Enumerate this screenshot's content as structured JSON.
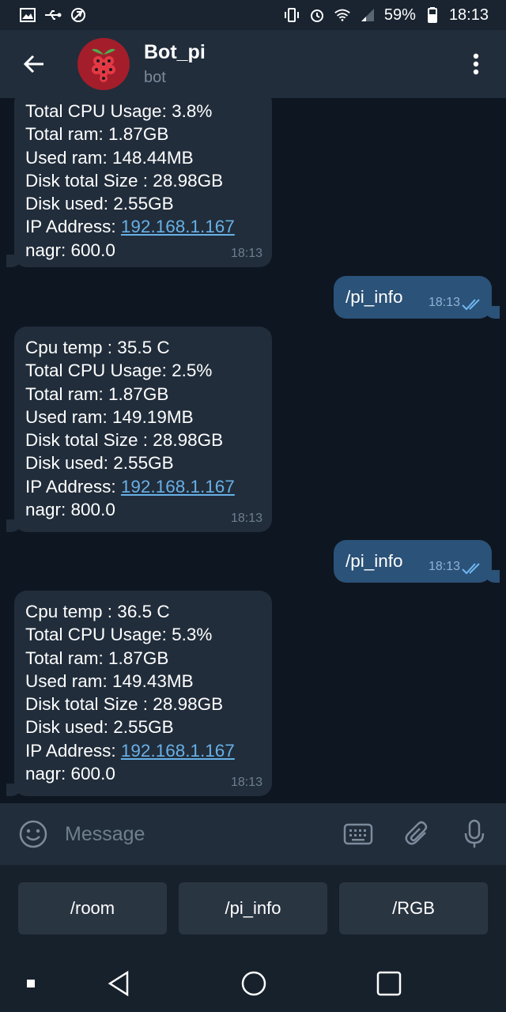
{
  "status_bar": {
    "battery": "59%",
    "time": "18:13",
    "icons_left": [
      "gallery-icon",
      "usb-icon",
      "no-location-icon"
    ],
    "icons_right": [
      "vibrate-icon",
      "alarm-icon",
      "wifi-icon",
      "signal-icon",
      "battery-icon"
    ]
  },
  "header": {
    "title": "Bot_pi",
    "subtitle": "bot"
  },
  "chat": {
    "messages": [
      {
        "direction": "in",
        "lines": [
          "Total CPU Usage: 3.8%",
          "Total ram: 1.87GB",
          "Used ram: 148.44MB",
          "Disk total Size : 28.98GB",
          "Disk used: 2.55GB"
        ],
        "ip_label": "IP Address: ",
        "ip": "192.168.1.167",
        "last_line": "nagr: 600.0",
        "time": "18:13"
      },
      {
        "direction": "out",
        "text": "/pi_info",
        "time": "18:13",
        "status": "read"
      },
      {
        "direction": "in",
        "lines": [
          "Cpu temp : 35.5 C",
          "Total CPU Usage: 2.5%",
          "Total ram: 1.87GB",
          "Used ram: 149.19MB",
          "Disk total Size : 28.98GB",
          "Disk used: 2.55GB"
        ],
        "ip_label": "IP Address: ",
        "ip": "192.168.1.167",
        "last_line": "nagr: 800.0",
        "time": "18:13"
      },
      {
        "direction": "out",
        "text": "/pi_info",
        "time": "18:13",
        "status": "read"
      },
      {
        "direction": "in",
        "lines": [
          "Cpu temp : 36.5 C",
          "Total CPU Usage: 5.3%",
          "Total ram: 1.87GB",
          "Used ram: 149.43MB",
          "Disk total Size : 28.98GB",
          "Disk used: 2.55GB"
        ],
        "ip_label": "IP Address: ",
        "ip": "192.168.1.167",
        "last_line": "nagr: 600.0",
        "time": "18:13"
      }
    ]
  },
  "input": {
    "placeholder": "Message",
    "value": ""
  },
  "keyboard": {
    "buttons": [
      "/room",
      "/pi_info",
      "/RGB"
    ]
  },
  "colors": {
    "chat_bg": "#0e1621",
    "incoming_bubble": "#212d3b",
    "outgoing_bubble": "#2b5278",
    "link": "#68b0e6",
    "avatar": "#a31e2a"
  }
}
